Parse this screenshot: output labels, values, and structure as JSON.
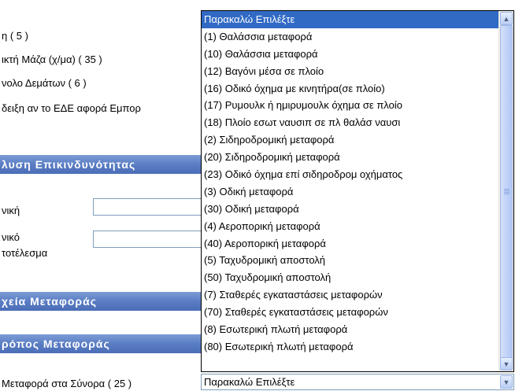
{
  "form": {
    "labels": [
      "η ( 5 )",
      "ικτή Μάζα (χ/μα) ( 35 )",
      "νολο Δεμάτων ( 6 )",
      "δειξη αν το ΕΔΕ αφορά Εμπορ",
      "νική",
      "νικό",
      "τοτέλεσμα",
      "Μεταφορά στα Σύνορα ( 25 )"
    ],
    "sections": [
      "λυση Επικινδυνότητας",
      "χεία Μεταφοράς",
      "ρόπος Μεταφοράς"
    ]
  },
  "dropdown": {
    "selected_value": "Παρακαλώ Επιλέξτε",
    "options": [
      "Παρακαλώ Επιλέξτε",
      "(1) Θαλάσσια μεταφορά",
      "(10) Θαλάσσια μεταφορά",
      "(12) Βαγόνι μέσα σε πλοίο",
      "(16) Οδικό όχημα με κινητήρα(σε πλοίο)",
      "(17) Ρυμουλκ ή ημιρυμουλκ όχημα σε πλοίο",
      "(18) Πλοίο εσωτ ναυσιπ σε πλ θαλάσ ναυσι",
      "(2) Σιδηροδρομική μεταφορά",
      "(20) Σιδηροδρομική μεταφορά",
      "(23) Οδικό όχημα επί σιδηροδρομ οχήματος",
      "(3) Οδική μεταφορά",
      "(30) Οδική μεταφορά",
      "(4) Αεροπορική μεταφορά",
      "(40) Αεροπορική μεταφορά",
      "(5) Ταχυδρομική αποστολή",
      "(50) Ταχυδρομική αποστολή",
      "(7) Σταθερές εγκαταστάσεις μεταφορών",
      "(70) Σταθερές εγκαταστάσεις μεταφορών",
      "(8) Εσωτερική πλωτή μεταφορά",
      "(80) Εσωτερική πλωτή μεταφορά"
    ],
    "highlighted_index": 0
  },
  "icons": {
    "scroll_up": "chevron-up-icon",
    "scroll_down": "chevron-down-icon",
    "select_arrow": "chevron-down-icon"
  },
  "colors": {
    "section_header": "#5a7dc4",
    "highlight": "#316ac5"
  }
}
